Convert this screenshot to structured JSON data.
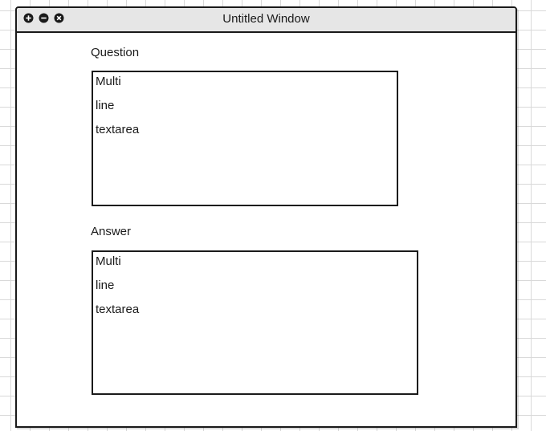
{
  "window": {
    "title": "Untitled Window",
    "controls": [
      "plus-icon",
      "minus-icon",
      "close-icon"
    ]
  },
  "question": {
    "label": "Question",
    "lines": [
      "Multi",
      "line",
      "textarea"
    ]
  },
  "answer": {
    "label": "Answer",
    "lines": [
      "Multi",
      "line",
      "textarea"
    ]
  }
}
